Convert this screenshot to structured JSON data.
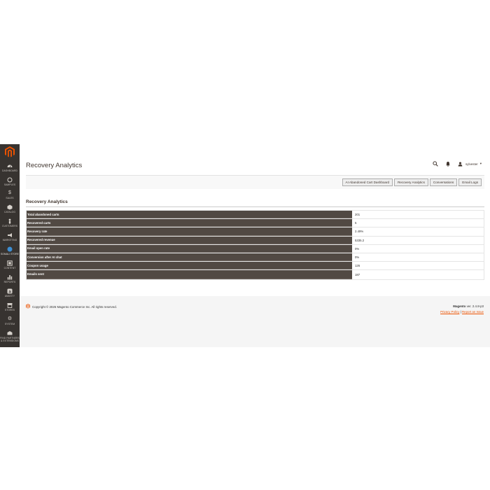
{
  "sidebar": {
    "items": [
      {
        "label": "DASHBOARD",
        "icon": "dashboard-icon"
      },
      {
        "label": "SAMPLES",
        "icon": "samples-icon"
      },
      {
        "label": "SALES",
        "icon": "dollar-icon"
      },
      {
        "label": "CATALOG",
        "icon": "catalog-icon"
      },
      {
        "label": "CUSTOMERS",
        "icon": "customers-icon"
      },
      {
        "label": "MARKETING",
        "icon": "megaphone-icon"
      },
      {
        "label": "SOMALI STORE",
        "icon": "store-icon",
        "active": true
      },
      {
        "label": "CONTENT",
        "icon": "content-icon"
      },
      {
        "label": "REPORTS",
        "icon": "reports-icon"
      },
      {
        "label": "AMASTY",
        "icon": "amasty-icon"
      },
      {
        "label": "STORES",
        "icon": "stores-icon"
      },
      {
        "label": "SYSTEM",
        "icon": "gear-icon"
      },
      {
        "label": "FIND PARTNERS",
        "label2": "& EXTENSIONS",
        "icon": "partners-icon"
      }
    ]
  },
  "header": {
    "title": "Recovery Analytics",
    "user": "sylvester"
  },
  "tabs": [
    {
      "label": "AI Abandoned Cart Dashboard"
    },
    {
      "label": "Recovery Analytics"
    },
    {
      "label": "Conversations"
    },
    {
      "label": "Email Logs"
    }
  ],
  "section": {
    "title": "Recovery Analytics"
  },
  "stats": [
    {
      "label": "Total abandoned carts",
      "value": "201"
    },
    {
      "label": "Recovered carts",
      "value": "5"
    },
    {
      "label": "Recovery rate",
      "value": "2.49%"
    },
    {
      "label": "Recovered revenue",
      "value": "5335.2"
    },
    {
      "label": "Email open rate",
      "value": "0%"
    },
    {
      "label": "Conversion after AI chat",
      "value": "0%"
    },
    {
      "label": "Coupon usage",
      "value": "126"
    },
    {
      "label": "Emails sent",
      "value": "187"
    }
  ],
  "footer": {
    "copyright": "Copyright © 2026 Magento Commerce Inc. All rights reserved.",
    "brand": "Magento",
    "version": "ver. 2.4.8-p3",
    "privacy": "Privacy Policy",
    "separator": "|",
    "report": "Report an Issue"
  },
  "colors": {
    "sidebar_bg": "#373330",
    "accent": "#eb5202",
    "label_bg": "#514943"
  }
}
